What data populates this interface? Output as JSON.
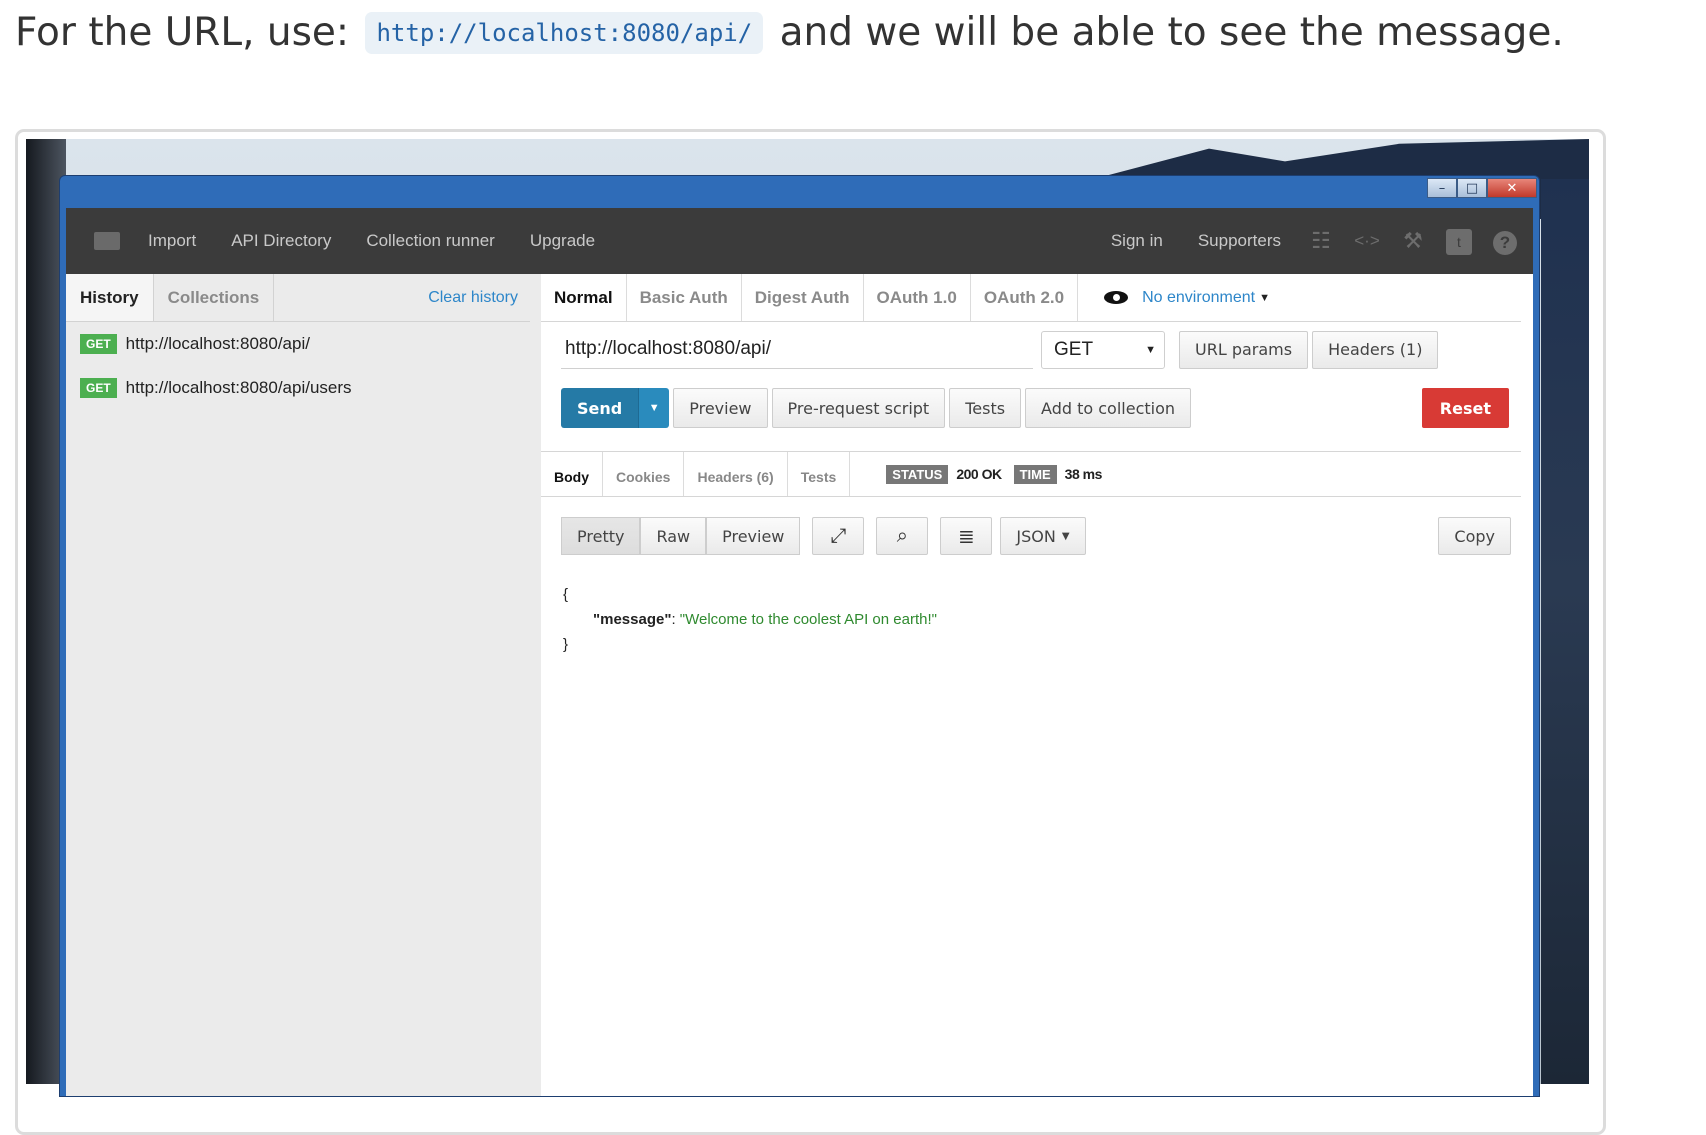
{
  "intro": {
    "before": "For the URL, use:",
    "code": "http://localhost:8080/api/",
    "after": "and we will be able to see the message."
  },
  "window": {
    "controls": {
      "minimize": "–",
      "maximize": "□",
      "close": "✕"
    }
  },
  "navbar": {
    "items": [
      "Import",
      "API Directory",
      "Collection runner",
      "Upgrade"
    ],
    "sign_in": "Sign in",
    "supporters": "Supporters",
    "icons": [
      "traffic-light-icon",
      "code-icon",
      "wrench-icon",
      "twitter-icon",
      "help-icon"
    ]
  },
  "sidebar": {
    "tabs": [
      "History",
      "Collections"
    ],
    "clear_history": "Clear history",
    "history": [
      {
        "method": "GET",
        "url": "http://localhost:8080/api/"
      },
      {
        "method": "GET",
        "url": "http://localhost:8080/api/users"
      }
    ]
  },
  "auth_tabs": [
    "Normal",
    "Basic Auth",
    "Digest Auth",
    "OAuth 1.0",
    "OAuth 2.0"
  ],
  "environment": "No environment",
  "request": {
    "url": "http://localhost:8080/api/",
    "method": "GET",
    "url_params": "URL params",
    "headers": "Headers (1)"
  },
  "actions": {
    "send": "Send",
    "preview": "Preview",
    "prerequest": "Pre-request script",
    "tests": "Tests",
    "add_to_collection": "Add to collection",
    "reset": "Reset"
  },
  "response": {
    "tabs": [
      "Body",
      "Cookies",
      "Headers (6)",
      "Tests"
    ],
    "status_label": "STATUS",
    "status": "200 OK",
    "time_label": "TIME",
    "time": "38 ms",
    "views": [
      "Pretty",
      "Raw",
      "Preview"
    ],
    "format": "JSON",
    "copy": "Copy",
    "body": {
      "open": "{",
      "key": "\"message\"",
      "colon": ": ",
      "value": "\"Welcome to the coolest API on earth!\"",
      "close": "}"
    }
  },
  "colors": {
    "send": "#257aa6",
    "reset": "#d83a35",
    "get_badge": "#4caf50",
    "link": "#2d86c9",
    "json_string": "#2f8a2f",
    "topbar": "#3b3b3b"
  }
}
